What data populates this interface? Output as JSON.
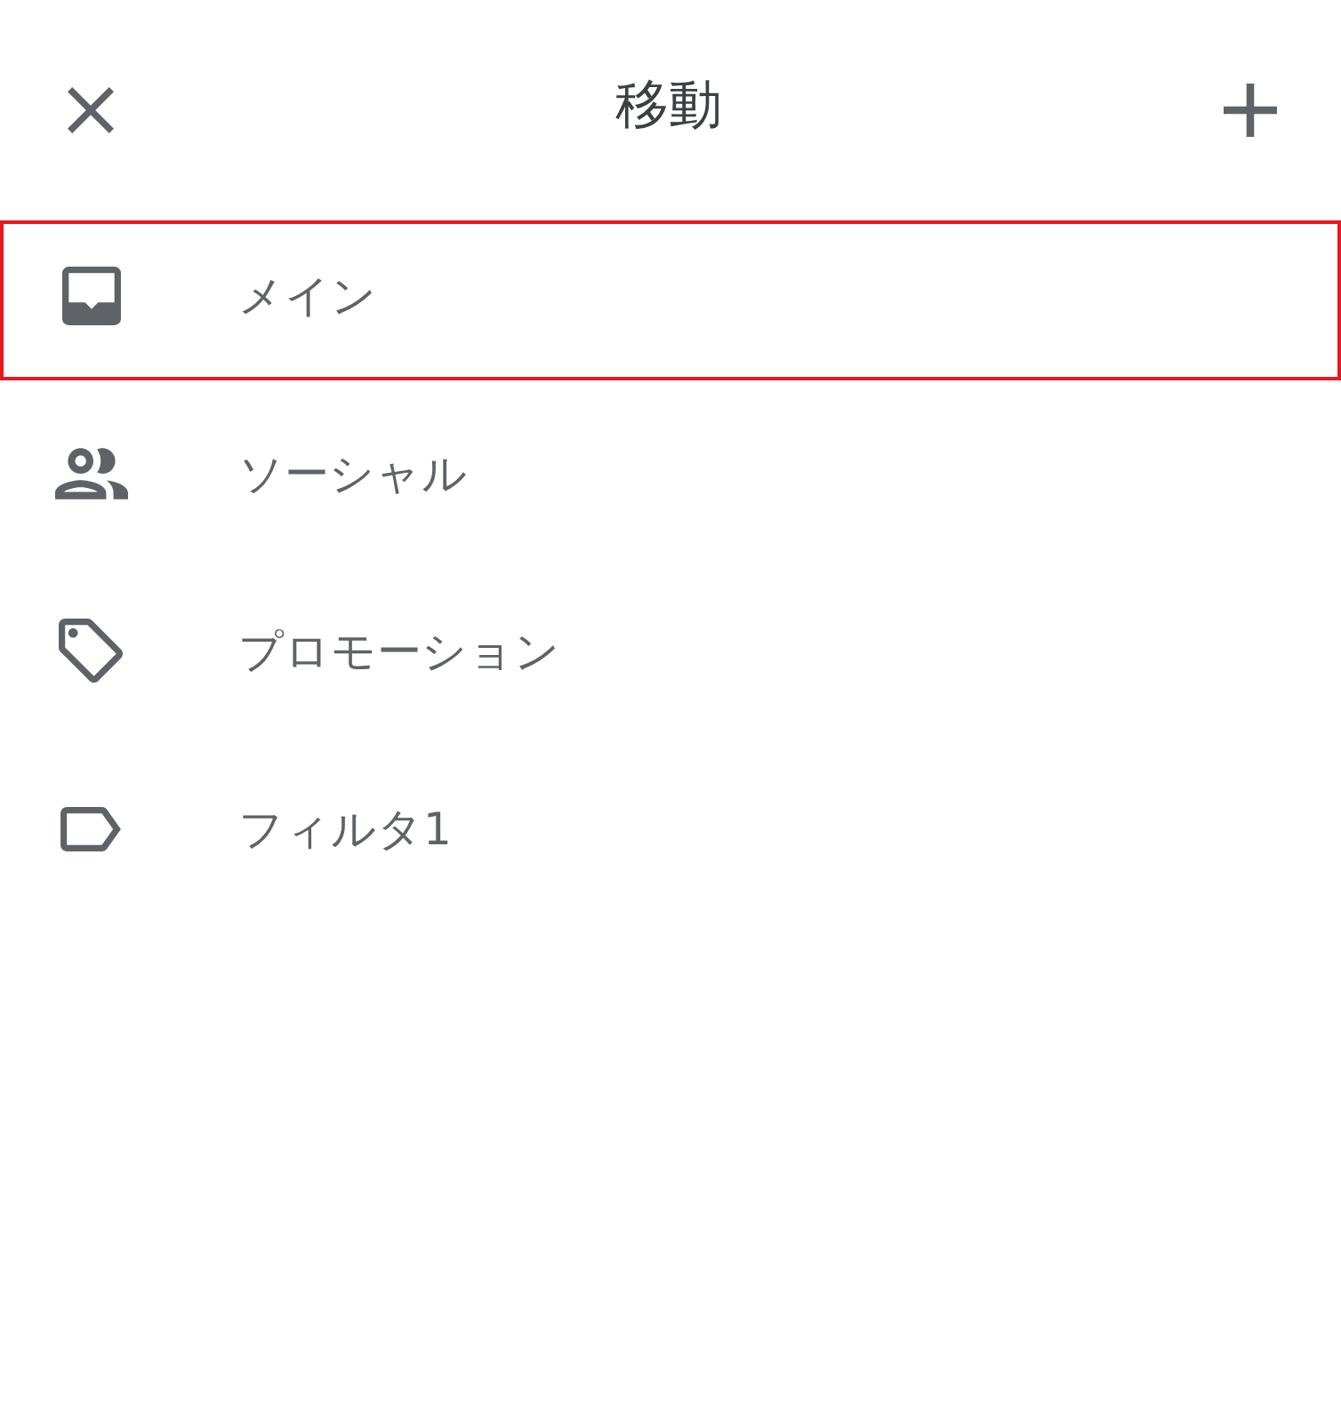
{
  "header": {
    "title": "移動"
  },
  "items": [
    {
      "label": "メイン",
      "kind": "inbox",
      "highlighted": true
    },
    {
      "label": "ソーシャル",
      "kind": "people",
      "highlighted": false
    },
    {
      "label": "プロモーション",
      "kind": "tag",
      "highlighted": false
    },
    {
      "label": "フィルタ1",
      "kind": "label",
      "highlighted": false
    }
  ]
}
